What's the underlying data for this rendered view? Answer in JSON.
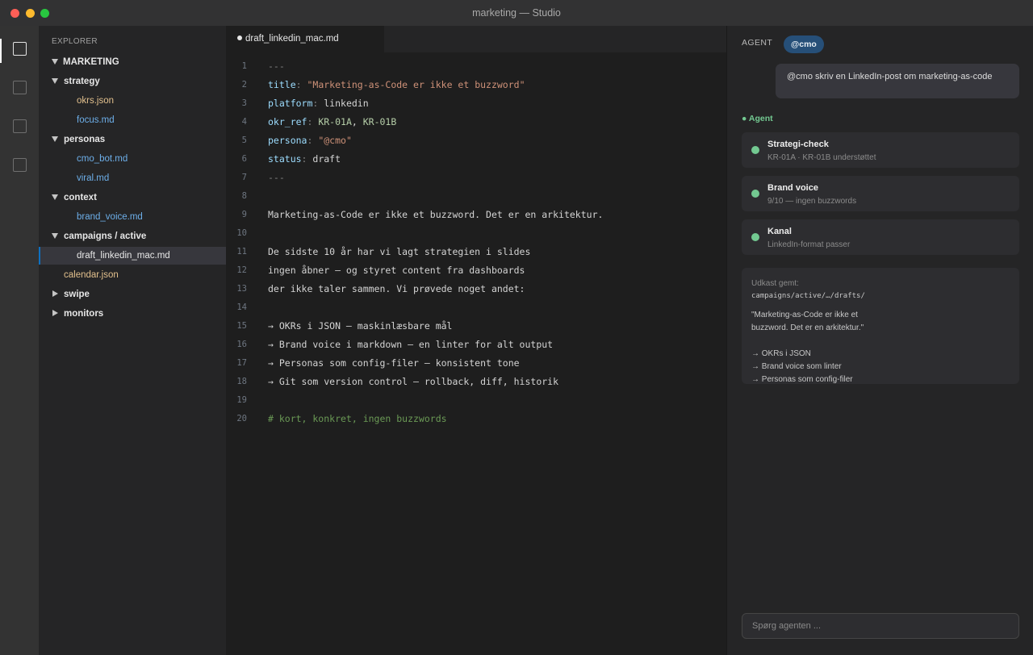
{
  "window": {
    "title": "marketing — Studio"
  },
  "activity_bar": {
    "items": [
      "explorer-icon",
      "search-icon",
      "source-control-icon",
      "extensions-icon"
    ]
  },
  "explorer": {
    "title": "EXPLORER",
    "root": "MARKETING",
    "tree": [
      {
        "type": "folder",
        "label": "strategy",
        "expanded": true
      },
      {
        "type": "file",
        "label": "okrs.json",
        "kind": "json"
      },
      {
        "type": "file",
        "label": "focus.md",
        "kind": "md"
      },
      {
        "type": "folder",
        "label": "personas",
        "expanded": true
      },
      {
        "type": "file",
        "label": "cmo_bot.md",
        "kind": "md"
      },
      {
        "type": "file",
        "label": "viral.md",
        "kind": "md"
      },
      {
        "type": "folder",
        "label": "context",
        "expanded": true
      },
      {
        "type": "file",
        "label": "brand_voice.md",
        "kind": "md"
      },
      {
        "type": "folder",
        "label": "campaigns / active",
        "expanded": true
      },
      {
        "type": "file",
        "label": "draft_linkedin_mac.md",
        "kind": "md",
        "selected": true
      },
      {
        "type": "file",
        "label": "calendar.json",
        "kind": "json"
      },
      {
        "type": "folder",
        "label": "swipe",
        "expanded": false
      },
      {
        "type": "folder",
        "label": "monitors",
        "expanded": false
      }
    ]
  },
  "editor": {
    "tab": {
      "label": "draft_linkedin_mac.md",
      "modified": true
    },
    "lines": [
      [
        [
          "p",
          "---"
        ]
      ],
      [
        [
          "k",
          "title"
        ],
        [
          "p",
          ": "
        ],
        [
          "s",
          "\"Marketing-as-Code er ikke et buzzword\""
        ]
      ],
      [
        [
          "k",
          "platform"
        ],
        [
          "p",
          ": "
        ],
        [
          "t",
          "linkedin"
        ]
      ],
      [
        [
          "k",
          "okr_ref"
        ],
        [
          "p",
          ": "
        ],
        [
          "n",
          "KR-01A"
        ],
        [
          "t",
          ", "
        ],
        [
          "n",
          "KR-01B"
        ]
      ],
      [
        [
          "k",
          "persona"
        ],
        [
          "p",
          ": "
        ],
        [
          "s",
          "\"@cmo\""
        ]
      ],
      [
        [
          "k",
          "status"
        ],
        [
          "p",
          ": "
        ],
        [
          "t",
          "draft"
        ]
      ],
      [
        [
          "p",
          "---"
        ]
      ],
      [],
      [
        [
          "t",
          "Marketing-as-Code er ikke et buzzword. Det er en arkitektur."
        ]
      ],
      [],
      [
        [
          "t",
          "De sidste 10 år har vi lagt strategien i slides"
        ]
      ],
      [
        [
          "t",
          "ingen åbner — og styret content fra dashboards"
        ]
      ],
      [
        [
          "t",
          "der ikke taler sammen. Vi prøvede noget andet:"
        ]
      ],
      [],
      [
        [
          "t",
          "→ OKRs i JSON — maskinlæsbare mål"
        ]
      ],
      [
        [
          "t",
          "→ Brand voice i markdown — en linter for alt output"
        ]
      ],
      [
        [
          "t",
          "→ Personas som config-filer — konsistent tone"
        ]
      ],
      [
        [
          "t",
          "→ Git som version control — rollback, diff, historik"
        ]
      ],
      [],
      [
        [
          "cm",
          "# kort, konkret, ingen buzzwords"
        ]
      ]
    ]
  },
  "agent": {
    "title": "AGENT",
    "chip": "@cmo",
    "user_message": "@cmo skriv en LinkedIn-post om marketing-as-code",
    "agent_label": "● Agent",
    "status_color": "#73c991",
    "checks": [
      {
        "title": "Strategi-check",
        "subtitle": "KR-01A · KR-01B understøttet"
      },
      {
        "title": "Brand voice",
        "subtitle": "9/10 — ingen buzzwords"
      },
      {
        "title": "Kanal",
        "subtitle": "LinkedIn-format passer"
      }
    ],
    "draft": {
      "label": "Udkast gemt:",
      "path": "campaigns/active/…/drafts/",
      "text": "\"Marketing-as-Code er ikke et\nbuzzword. Det er en arkitektur.\"\n\n→ OKRs i JSON\n→ Brand voice som linter\n→ Personas som config-filer"
    },
    "input_placeholder": "Spørg agenten ..."
  }
}
